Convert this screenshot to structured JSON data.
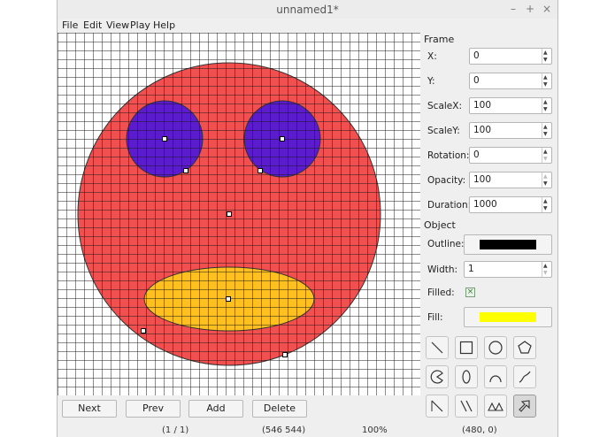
{
  "window": {
    "title": "unnamed1*",
    "controls": {
      "minimize": "–",
      "maximize": "+",
      "close": "×"
    }
  },
  "menu": {
    "items": [
      "File",
      "Edit",
      "View",
      "Play",
      "Help"
    ]
  },
  "canvas": {
    "face_fill": "#f05050",
    "eye_fill": "#5a1ccc",
    "mouth_fill": "#ffc020",
    "grid_color": "#1a1a1a"
  },
  "frame": {
    "heading": "Frame",
    "fields": [
      {
        "label": "X:",
        "value": "0"
      },
      {
        "label": "Y:",
        "value": "0"
      },
      {
        "label": "ScaleX:",
        "value": "100"
      },
      {
        "label": "ScaleY:",
        "value": "100"
      },
      {
        "label": "Rotation:",
        "value": "0"
      },
      {
        "label": "Opacity:",
        "value": "100"
      },
      {
        "label": "Duration:",
        "value": "1000"
      }
    ]
  },
  "object": {
    "heading": "Object",
    "outline_label": "Outline:",
    "outline_color": "#000000",
    "width_label": "Width:",
    "width_value": "1",
    "filled_label": "Filled:",
    "filled_mark": "×",
    "fill_label": "Fill:",
    "fill_color": "#ffff00"
  },
  "tools": [
    "line-tool",
    "rectangle-tool",
    "circle-tool",
    "polygon-tool",
    "pie-tool",
    "ellipse-tool",
    "arc-tool",
    "curve-tool",
    "diagonal-line-tool",
    "double-line-tool",
    "triangles-tool",
    "pointer-tool"
  ],
  "buttons": {
    "next": "Next",
    "prev": "Prev",
    "add": "Add",
    "delete": "Delete"
  },
  "status": {
    "frame": "(1 / 1)",
    "cursor": "(546 544)",
    "zoom": "100%",
    "position": "(480, 0)"
  }
}
